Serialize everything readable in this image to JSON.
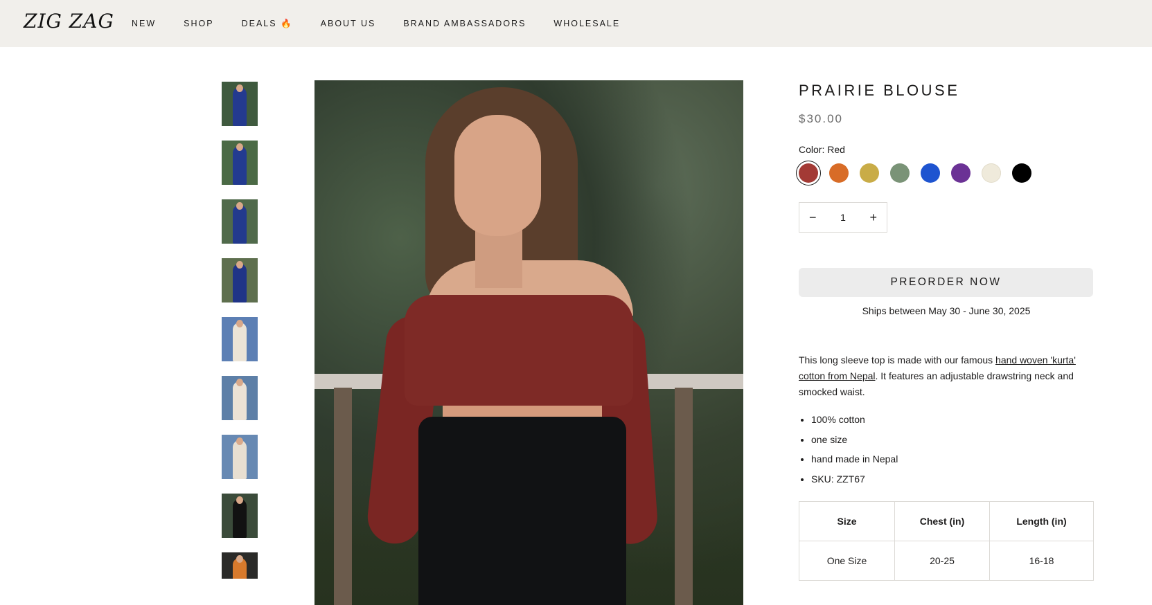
{
  "header": {
    "logo": "ZIG ZAG",
    "nav": [
      "NEW",
      "SHOP",
      "DEALS 🔥",
      "ABOUT US",
      "BRAND AMBASSADORS",
      "WHOLESALE"
    ]
  },
  "gallery": {
    "thumbnails": [
      {
        "bg": "#3f5a3e",
        "outfit": "#243a8f"
      },
      {
        "bg": "#4b6a45",
        "outfit": "#233b90"
      },
      {
        "bg": "#506a4b",
        "outfit": "#233a8d"
      },
      {
        "bg": "#5e6f4e",
        "outfit": "#203487"
      },
      {
        "bg": "#5c7fb4",
        "outfit": "#ece4d6"
      },
      {
        "bg": "#5d7fa7",
        "outfit": "#ece2d5"
      },
      {
        "bg": "#6789b3",
        "outfit": "#e8dfd1"
      },
      {
        "bg": "#3b4b3a",
        "outfit": "#121212"
      },
      {
        "bg": "#2a2a28",
        "outfit": "#d87a2c"
      }
    ]
  },
  "product": {
    "title": "PRAIRIE BLOUSE",
    "price": "$30.00",
    "color_label": "Color: Red",
    "swatches": [
      {
        "name": "Red",
        "hex": "#a33a35",
        "selected": true
      },
      {
        "name": "Orange",
        "hex": "#d86c27",
        "selected": false
      },
      {
        "name": "Mustard",
        "hex": "#c9ac47",
        "selected": false
      },
      {
        "name": "Sage",
        "hex": "#7a9377",
        "selected": false
      },
      {
        "name": "Blue",
        "hex": "#1e54d0",
        "selected": false
      },
      {
        "name": "Purple",
        "hex": "#6b3295",
        "selected": false
      },
      {
        "name": "Cream",
        "hex": "#efeadb",
        "selected": false
      },
      {
        "name": "Black",
        "hex": "#000000",
        "selected": false
      }
    ],
    "quantity": {
      "minus": "−",
      "value": "1",
      "plus": "+"
    },
    "preorder_label": "PREORDER NOW",
    "ships_text": "Ships between May 30 - June 30, 2025",
    "description": {
      "before": "This long sleeve top is made with our famous ",
      "link": "hand woven 'kurta' cotton from Nepal",
      "after": ". It features an adjustable drawstring neck and smocked waist."
    },
    "bullets": [
      "100% cotton",
      "one size",
      "hand made in Nepal",
      "SKU: ZZT67"
    ],
    "size_table": {
      "headers": [
        "Size",
        "Chest (in)",
        "Length (in)"
      ],
      "rows": [
        [
          "One Size",
          "20-25",
          "16-18"
        ]
      ]
    }
  }
}
